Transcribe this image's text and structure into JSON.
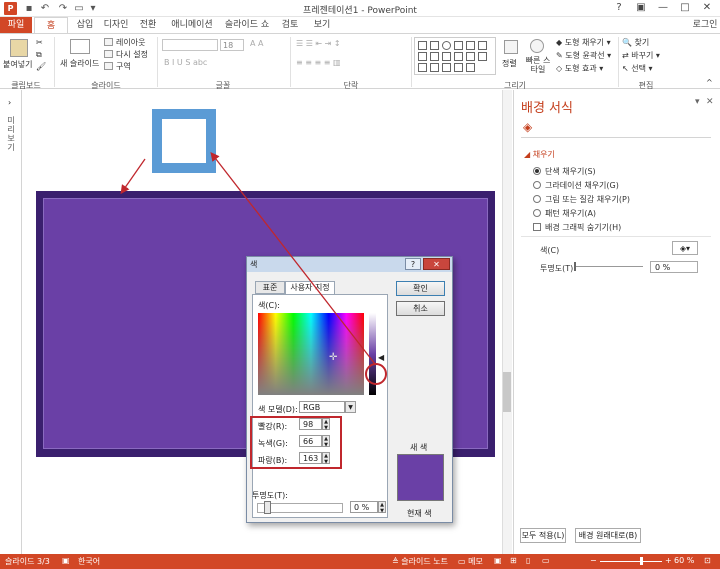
{
  "titlebar": {
    "app_icon": "P",
    "title": "프레젠테이션1 - PowerPoint",
    "undo_icon": "undo-icon",
    "redo_icon": "redo-icon",
    "help": "?",
    "ribbon_opts": "▣",
    "minimize": "—",
    "maximize": "□",
    "close": "✕"
  },
  "tabs": [
    "파일",
    "홈",
    "삽입",
    "디자인",
    "전환",
    "애니메이션",
    "슬라이드 쇼",
    "검토",
    "보기"
  ],
  "account": "로그인",
  "ribbon": {
    "clipboard": {
      "paste": "붙여넣기",
      "label": "클립보드"
    },
    "slides": {
      "new_slide": "새 슬라이드",
      "layout": "레이아웃",
      "reset": "다시 설정",
      "section": "구역",
      "label": "슬라이드"
    },
    "font": {
      "size": "18",
      "label": "글꼴"
    },
    "paragraph": {
      "label": "단락"
    },
    "drawing": {
      "arrange": "정렬",
      "quick_styles": "빠른 스타일",
      "shape_fill": "도형 채우기",
      "shape_outline": "도형 윤곽선",
      "shape_effects": "도형 효과",
      "label": "그리기"
    },
    "editing": {
      "find": "찾기",
      "replace": "바꾸기",
      "select": "선택",
      "label": "편집"
    }
  },
  "thumbnails_label": "미리보기",
  "dialog": {
    "title": "색",
    "help": "?",
    "close": "✕",
    "tab_standard": "표준",
    "tab_custom": "사용자 지정",
    "colors_label": "색(C):",
    "ok": "확인",
    "cancel": "취소",
    "color_model_label": "색 모델(D):",
    "color_model_value": "RGB",
    "red_label": "빨강(R):",
    "red_value": "98",
    "green_label": "녹색(G):",
    "green_value": "66",
    "blue_label": "파랑(B):",
    "blue_value": "163",
    "new_label": "새 색",
    "current_label": "현재 색",
    "transparency_label": "투명도(T):",
    "transparency_value": "0 %",
    "new_color": "#6240a3"
  },
  "format_pane": {
    "title": "배경 서식",
    "fill_section": "채우기",
    "options": [
      "단색 채우기(S)",
      "그라데이션 채우기(G)",
      "그림 또는 질감 채우기(P)",
      "패턴 채우기(A)"
    ],
    "selected_option": 0,
    "hide_background": "배경 그래픽 숨기기(H)",
    "color_label": "색(C)",
    "transparency_label": "투명도(T)",
    "transparency_value": "0 %",
    "apply_all": "모두 적용(L)",
    "reset_background": "배경 원래대로(B)"
  },
  "status": {
    "slide": "슬라이드 3/3",
    "language": "한국어",
    "notes": "슬라이드 노트",
    "comments": "메모",
    "zoom": "60 %"
  },
  "colors": {
    "accent": "#d24726",
    "slide_bg": "#6a40a6",
    "slide_border": "#3a1f6e",
    "shape_fill": "#5b9bd5",
    "annotation": "#c0272d"
  }
}
